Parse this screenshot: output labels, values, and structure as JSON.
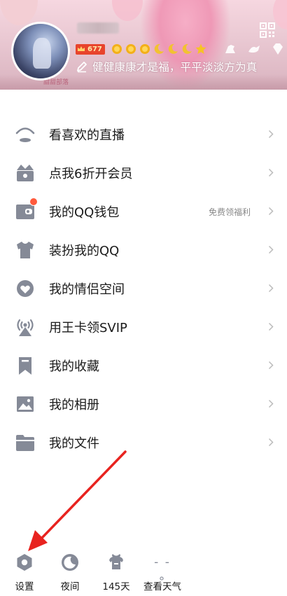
{
  "profile": {
    "vip_level": "677",
    "signature": "健健康康才是福，平平淡淡方为真",
    "avatar": "user-avatar",
    "small_logo_text": "甜甜部落"
  },
  "menu": {
    "items": [
      {
        "label": "看喜欢的直播",
        "icon": "live-icon"
      },
      {
        "label": "点我6折开会员",
        "icon": "crown-box-icon"
      },
      {
        "label": "我的QQ钱包",
        "icon": "wallet-icon",
        "hint": "免费领福利",
        "has_dot": true
      },
      {
        "label": "装扮我的QQ",
        "icon": "shirt-icon"
      },
      {
        "label": "我的情侣空间",
        "icon": "couple-heart-icon"
      },
      {
        "label": "用王卡领SVIP",
        "icon": "signal-tower-icon"
      },
      {
        "label": "我的收藏",
        "icon": "bookmark-icon"
      },
      {
        "label": "我的相册",
        "icon": "photo-album-icon"
      },
      {
        "label": "我的文件",
        "icon": "folder-icon"
      }
    ]
  },
  "bottom_bar": {
    "items": [
      {
        "label": "设置",
        "icon": "settings-hexagon-icon"
      },
      {
        "label": "夜间",
        "icon": "moon-icon"
      },
      {
        "label": "145天",
        "icon": "dress-streak-icon"
      },
      {
        "label": "查看天气",
        "icon": "weather-icon",
        "icon_text": "- -°"
      }
    ]
  },
  "colors": {
    "icon_gray": "#858a97",
    "vip_red": "#e8442c",
    "dot_red": "#ff5a3c",
    "arrow_red": "#e8231f"
  }
}
